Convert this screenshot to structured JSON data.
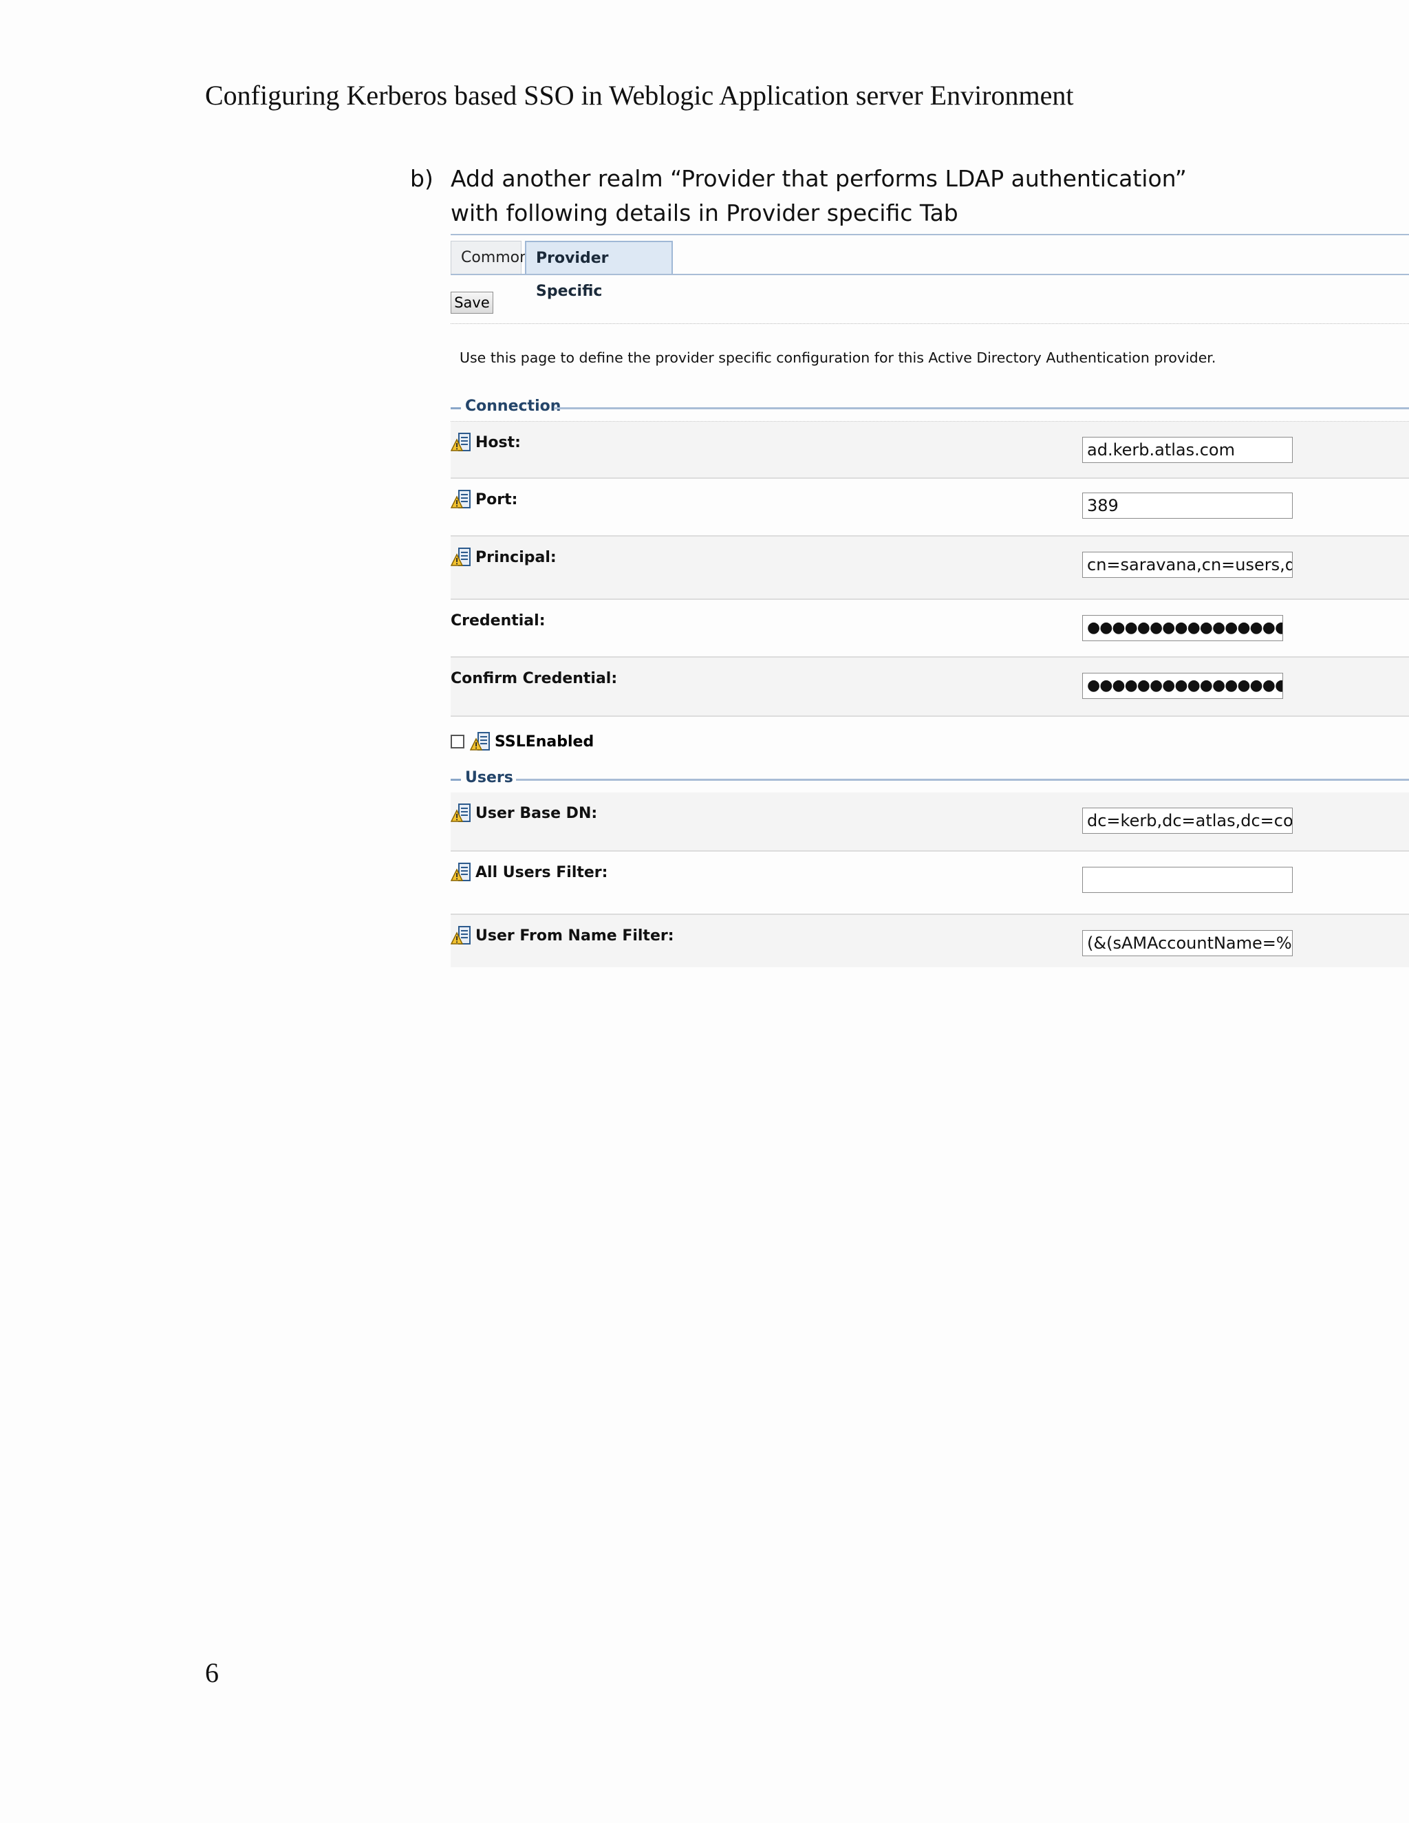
{
  "document": {
    "header": "Configuring Kerberos based SSO in Weblogic Application server Environment",
    "step_marker": "b)",
    "step_text": "Add another realm “Provider that performs LDAP authentication” with following details in Provider specific Tab",
    "page_number": "6"
  },
  "console": {
    "tabs": [
      {
        "label": "Common",
        "active": false
      },
      {
        "label": "Provider Specific",
        "active": true
      }
    ],
    "save_label": "Save",
    "description": "Use this page to define the provider specific configuration for this Active Directory Authentication provider.",
    "connection": {
      "title": "Connection",
      "host": {
        "label": "Host:",
        "value": "ad.kerb.atlas.com"
      },
      "port": {
        "label": "Port:",
        "value": "389"
      },
      "principal": {
        "label": "Principal:",
        "value": "cn=saravana,cn=users,dc="
      },
      "credential": {
        "label": "Credential:",
        "value": "●●●●●●●●●●●●●●●●●●●"
      },
      "confirm_credential": {
        "label": "Confirm Credential:",
        "value": "●●●●●●●●●●●●●●●●●●●"
      },
      "ssl_enabled": {
        "label": "SSLEnabled",
        "checked": false
      }
    },
    "users": {
      "title": "Users",
      "user_base_dn": {
        "label": "User Base DN:",
        "value": "dc=kerb,dc=atlas,dc=com"
      },
      "all_users_filter": {
        "label": "All Users Filter:",
        "value": ""
      },
      "user_from_name_filter": {
        "label": "User From Name Filter:",
        "value": "(&(sAMAccountName=%u"
      }
    },
    "colors": {
      "section_title": "#24456a",
      "rule": "#a9bdd6",
      "row_shade": "#f4f4f4"
    }
  }
}
